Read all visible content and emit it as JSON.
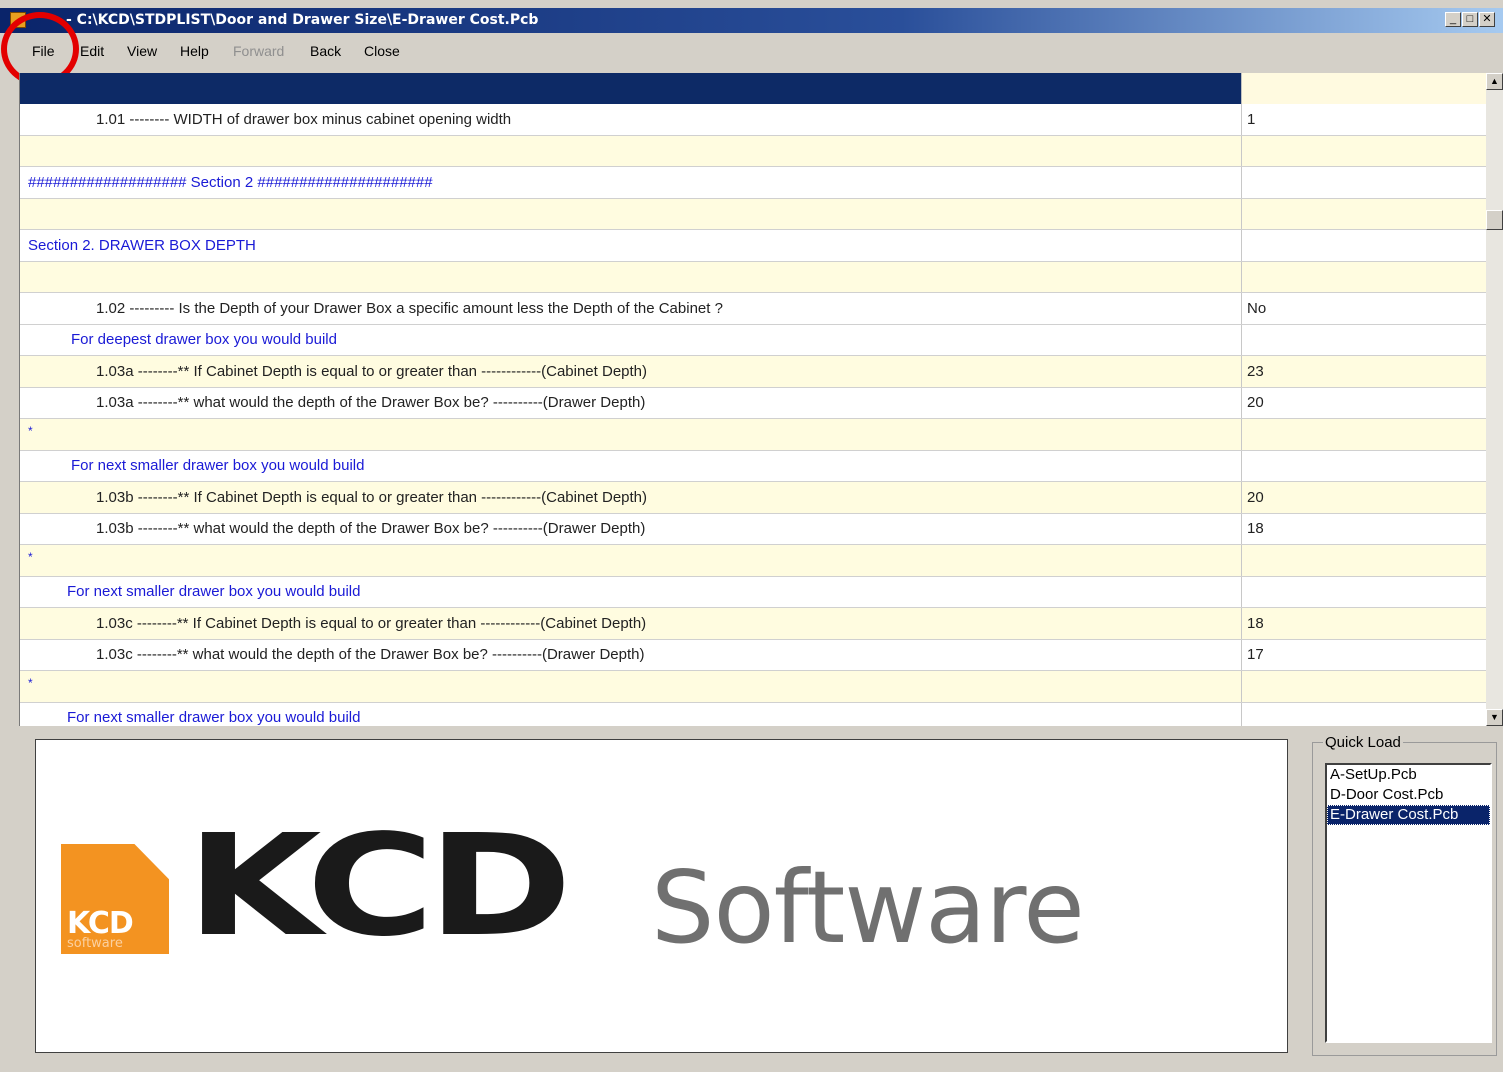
{
  "window": {
    "title": "- C:\\KCD\\STDPLIST\\Door and Drawer Size\\E-Drawer Cost.Pcb",
    "buttons": {
      "minimize": "_",
      "maximize": "□",
      "close": "✕"
    }
  },
  "menu": {
    "file": "File",
    "edit": "Edit",
    "view": "View",
    "help": "Help",
    "forward": "Forward",
    "back": "Back",
    "close": "Close"
  },
  "grid": {
    "rows": [
      {
        "text": "1.01 -------- WIDTH of drawer box minus cabinet opening width",
        "value": "1"
      },
      {
        "text": "",
        "value": ""
      },
      {
        "text": "################### Section 2 #####################",
        "value": ""
      },
      {
        "text": "",
        "value": ""
      },
      {
        "text": "Section 2.  DRAWER BOX DEPTH",
        "value": ""
      },
      {
        "text": "",
        "value": ""
      },
      {
        "text": "1.02 --------- Is the Depth of your Drawer Box a specific amount less the Depth of the Cabinet ?",
        "value": "No"
      },
      {
        "text": "For deepest drawer box you would build",
        "value": ""
      },
      {
        "text": "1.03a --------** If Cabinet Depth is equal to or greater than ------------(Cabinet Depth)",
        "value": "23"
      },
      {
        "text": "1.03a --------** what would the depth of the Drawer Box be? ----------(Drawer Depth)",
        "value": "20"
      },
      {
        "text": "*",
        "value": ""
      },
      {
        "text": "For next smaller drawer box you would build",
        "value": ""
      },
      {
        "text": "1.03b --------** If Cabinet Depth is equal to or greater than ------------(Cabinet Depth)",
        "value": "20"
      },
      {
        "text": "1.03b --------** what would the depth of the Drawer Box be? ----------(Drawer Depth)",
        "value": "18"
      },
      {
        "text": "*",
        "value": ""
      },
      {
        "text": "For next smaller drawer box you would build",
        "value": ""
      },
      {
        "text": "1.03c --------** If Cabinet Depth is equal to or greater than ------------(Cabinet Depth)",
        "value": "18"
      },
      {
        "text": "1.03c --------** what would the depth of the Drawer Box be? ----------(Drawer Depth)",
        "value": "17"
      },
      {
        "text": "*",
        "value": ""
      },
      {
        "text": "For next smaller drawer box you would build",
        "value": ""
      }
    ]
  },
  "scrollbar": {
    "up": "▲",
    "down": "▼"
  },
  "logo": {
    "mark_kcd": "KCD",
    "mark_software": "software",
    "kcd": "KCD",
    "software": "Software"
  },
  "quick_load": {
    "title": "Quick Load",
    "items": [
      "A-SetUp.Pcb",
      "D-Door Cost.Pcb",
      "E-Drawer Cost.Pcb"
    ],
    "selected": "E-Drawer Cost.Pcb"
  }
}
